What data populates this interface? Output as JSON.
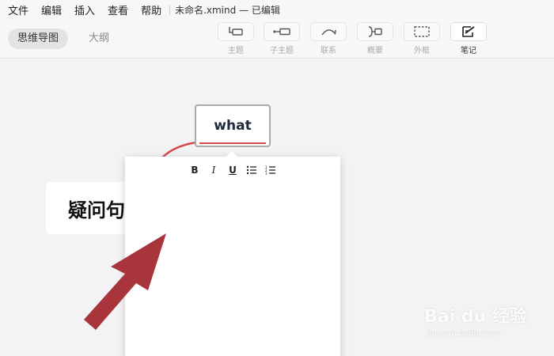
{
  "menubar": {
    "items": [
      "文件",
      "编辑",
      "插入",
      "查看",
      "帮助"
    ],
    "doc_title": "未命名.xmind — 已编辑"
  },
  "view_tabs": {
    "mindmap": "思维导图",
    "outline": "大纲"
  },
  "tools": {
    "topic": "主题",
    "subtopic": "子主题",
    "relationship": "联系",
    "summary": "概要",
    "boundary": "外框",
    "notes": "笔记"
  },
  "canvas": {
    "topic_main": "what",
    "topic_question": "疑问句"
  },
  "note_editor": {
    "bold": "B",
    "italic": "I",
    "underline": "U"
  },
  "watermark": {
    "main": "Bai du 经验",
    "sub": "jingyan.baidu.com"
  },
  "colors": {
    "accent_red": "#d34a4a",
    "arrow_red": "#a8343c"
  }
}
